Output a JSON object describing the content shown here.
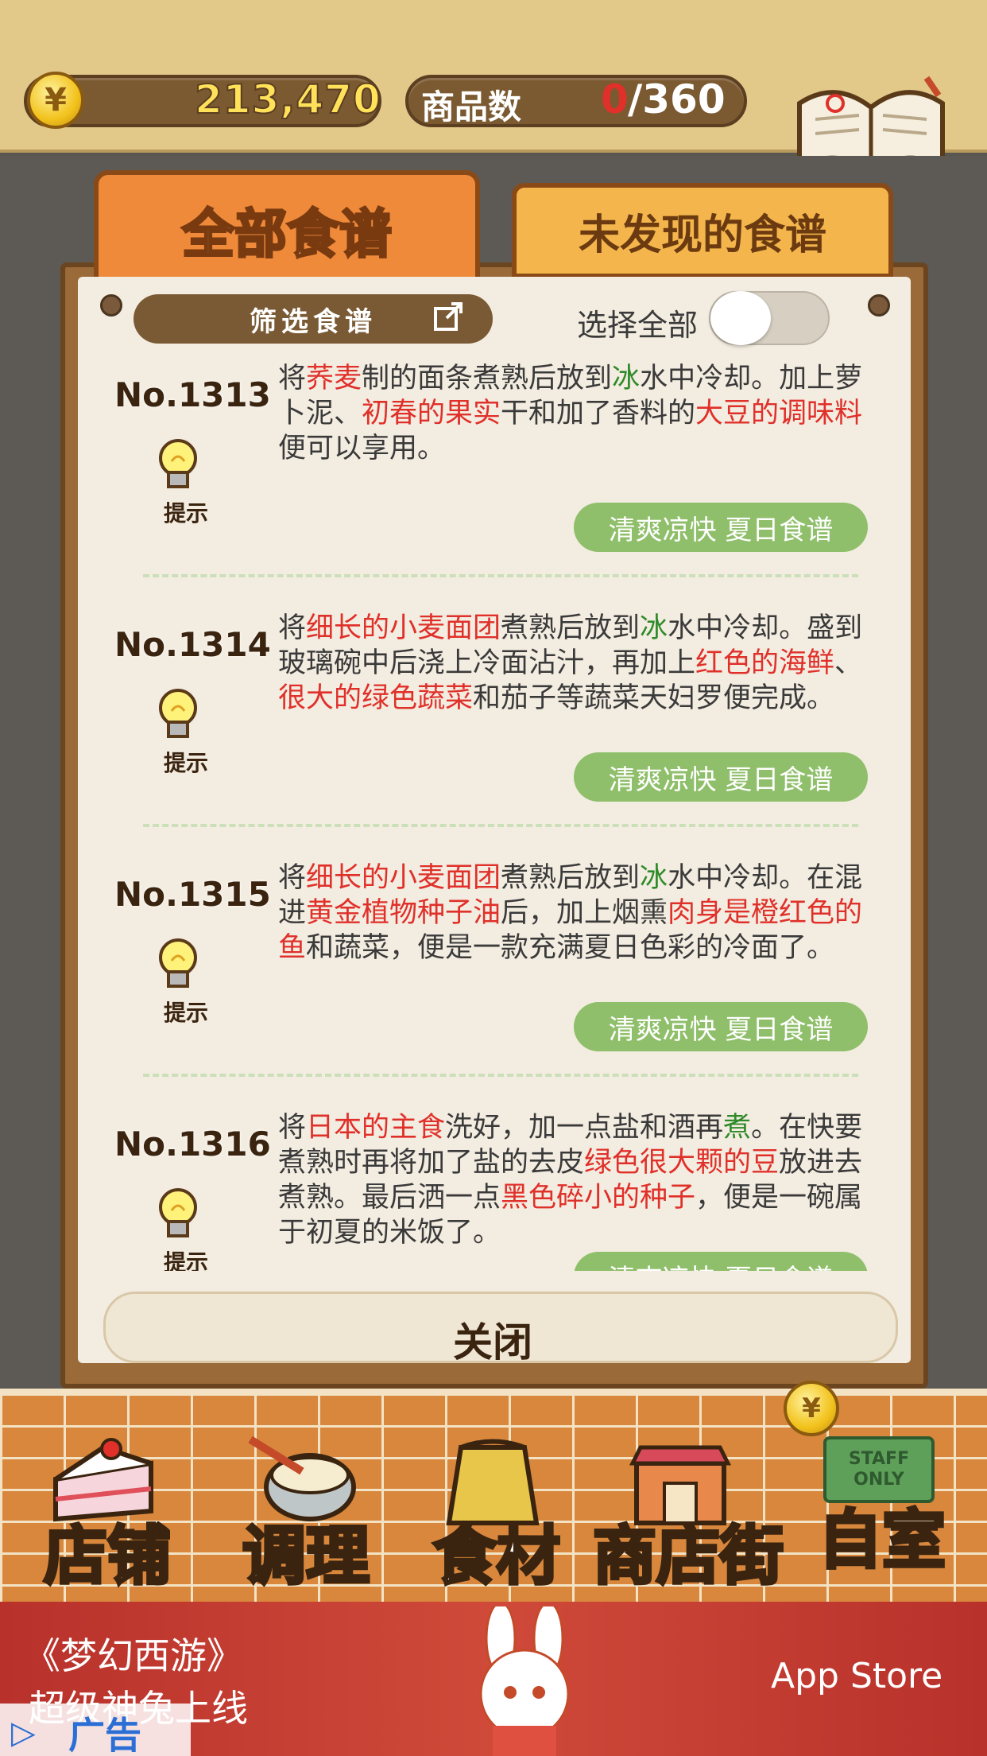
{
  "header": {
    "money": "213,470",
    "goods_label": "商品数",
    "goods_current": "0",
    "goods_total": "/360",
    "recipe_book_label": "食谱",
    "coin_symbol": "¥"
  },
  "tabs": {
    "all": "全部食谱",
    "undiscovered": "未发现的食谱"
  },
  "filter": {
    "label": "筛选食谱",
    "select_all": "选择全部"
  },
  "entries": [
    {
      "no": "No.1313",
      "hint": "提示",
      "tag": "清爽凉快 夏日食谱",
      "segments": [
        [
          "将",
          ""
        ],
        [
          "荞麦",
          "r"
        ],
        [
          "制的面条煮熟后放到",
          ""
        ],
        [
          "冰",
          "g"
        ],
        [
          "水中冷却。加上萝卜泥、",
          ""
        ],
        [
          "初春的果实",
          "r"
        ],
        [
          "干和加了香料的",
          ""
        ],
        [
          "大豆的调味料",
          "r"
        ],
        [
          "便可以享用。",
          ""
        ]
      ]
    },
    {
      "no": "No.1314",
      "hint": "提示",
      "tag": "清爽凉快 夏日食谱",
      "segments": [
        [
          "将",
          ""
        ],
        [
          "细长的小麦面团",
          "r"
        ],
        [
          "煮熟后放到",
          ""
        ],
        [
          "冰",
          "g"
        ],
        [
          "水中冷却。盛到玻璃碗中后浇上冷面沾汁，再加上",
          ""
        ],
        [
          "红色的海鲜",
          "r"
        ],
        [
          "、",
          ""
        ],
        [
          "很大的绿色蔬菜",
          "r"
        ],
        [
          "和茄子等蔬菜天妇罗便完成。",
          ""
        ]
      ]
    },
    {
      "no": "No.1315",
      "hint": "提示",
      "tag": "清爽凉快 夏日食谱",
      "segments": [
        [
          "将",
          ""
        ],
        [
          "细长的小麦面团",
          "r"
        ],
        [
          "煮熟后放到",
          ""
        ],
        [
          "冰",
          "g"
        ],
        [
          "水中冷却。在混进",
          ""
        ],
        [
          "黄金植物种子油",
          "r"
        ],
        [
          "后，加上烟熏",
          ""
        ],
        [
          "肉身是橙红色的鱼",
          "r"
        ],
        [
          "和蔬菜，便是一款充满夏日色彩的冷面了。",
          ""
        ]
      ]
    },
    {
      "no": "No.1316",
      "hint": "提示",
      "tag": "清爽凉快 夏日食谱",
      "segments": [
        [
          "将",
          ""
        ],
        [
          "日本的主食",
          "r"
        ],
        [
          "洗好，加一点盐和酒再",
          ""
        ],
        [
          "煮",
          "g"
        ],
        [
          "。在快要煮熟时再将加了盐的去皮",
          ""
        ],
        [
          "绿色很大颗的豆",
          "r"
        ],
        [
          "放进去煮熟。最后洒一点",
          ""
        ],
        [
          "黑色碎小的种子",
          "r"
        ],
        [
          "，便是一碗属于初夏的米饭了。",
          ""
        ]
      ]
    }
  ],
  "close_label": "关闭",
  "nav": {
    "items": [
      "店铺",
      "调理",
      "食材",
      "商店街",
      "自室"
    ],
    "staff_sign": "STAFF ONLY"
  },
  "ad": {
    "title": "《梦幻西游》",
    "subtitle": "超级神兔上线",
    "store": " App Store",
    "badge": "广告"
  },
  "colors": {
    "highlight_red": "#e0302a",
    "highlight_green": "#2f8a2a",
    "tag_green": "#8fbf6a",
    "tab_active": "#ef8a3a",
    "tab_inactive": "#f3b54c"
  }
}
